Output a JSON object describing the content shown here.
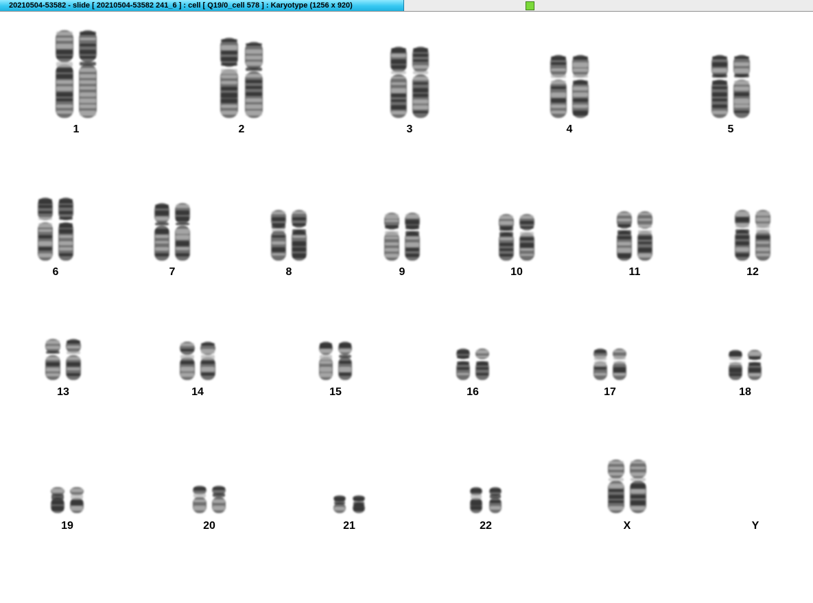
{
  "window": {
    "title": "20210504-53582 - slide [ 20210504-53582 241_6 ] : cell [ Q19/0_cell 578 ] : Karyotype  (1256 x 920)",
    "status_indicator_color": "#7bd93a"
  },
  "karyotype": {
    "chromosomes": [
      {
        "label": "1"
      },
      {
        "label": "2"
      },
      {
        "label": "3"
      },
      {
        "label": "4"
      },
      {
        "label": "5"
      },
      {
        "label": "6"
      },
      {
        "label": "7"
      },
      {
        "label": "8"
      },
      {
        "label": "9"
      },
      {
        "label": "10"
      },
      {
        "label": "11"
      },
      {
        "label": "12"
      },
      {
        "label": "13"
      },
      {
        "label": "14"
      },
      {
        "label": "15"
      },
      {
        "label": "16"
      },
      {
        "label": "17"
      },
      {
        "label": "18"
      },
      {
        "label": "19"
      },
      {
        "label": "20"
      },
      {
        "label": "21"
      },
      {
        "label": "22"
      },
      {
        "label": "X"
      },
      {
        "label": "Y"
      }
    ]
  }
}
